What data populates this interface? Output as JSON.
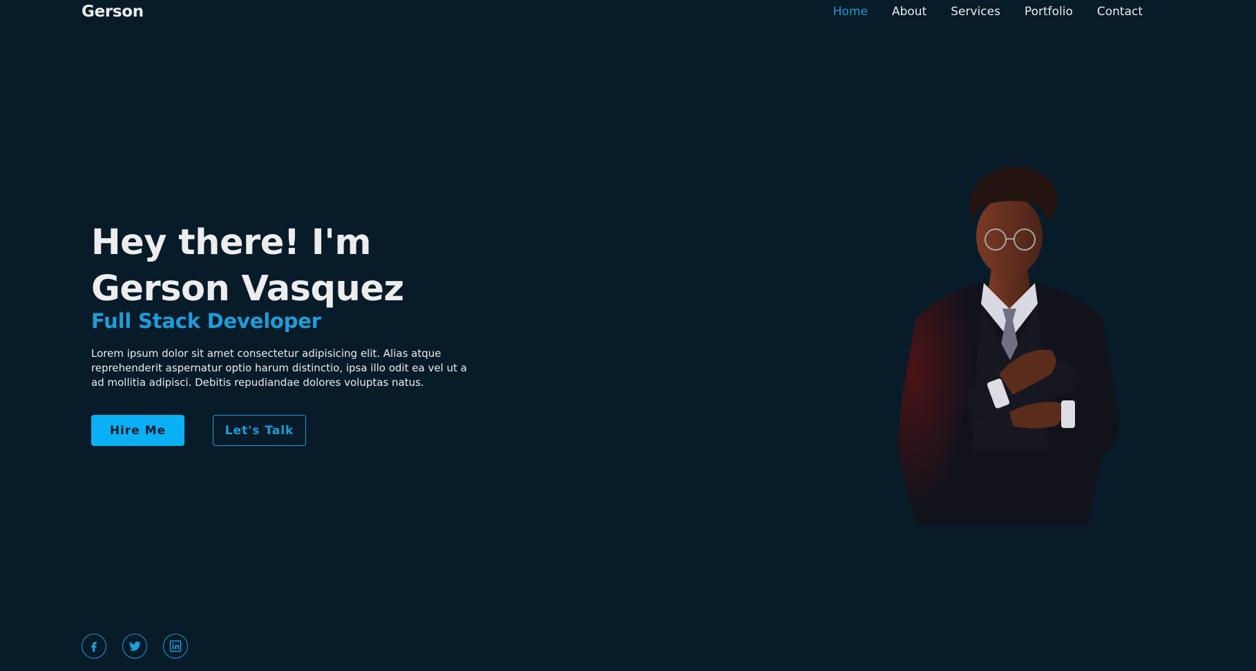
{
  "header": {
    "logo": "Gerson",
    "nav": [
      "Home",
      "About",
      "Services",
      "Portfolio",
      "Contact"
    ],
    "active_nav": "Home"
  },
  "hero": {
    "title_line1": "Hey there! I'm",
    "title_line2": "Gerson Vasquez",
    "subtitle": "Full Stack Developer",
    "description": "Lorem ipsum dolor sit amet consectetur adipisicing elit. Alias atque reprehenderit aspernatur optio harum distinctio, ipsa illo odit ea vel ut a ad mollitia adipisci. Debitis repudiandae dolores voluptas natus.",
    "primary_button": "Hire Me",
    "secondary_button": "Let's Talk"
  },
  "socials": [
    {
      "icon": "facebook-icon"
    },
    {
      "icon": "twitter-icon"
    },
    {
      "icon": "linkedin-icon"
    }
  ],
  "colors": {
    "background": "#081b29",
    "accent": "#1d9ed9",
    "button": "#0ab0f3",
    "text": "#ededed"
  }
}
